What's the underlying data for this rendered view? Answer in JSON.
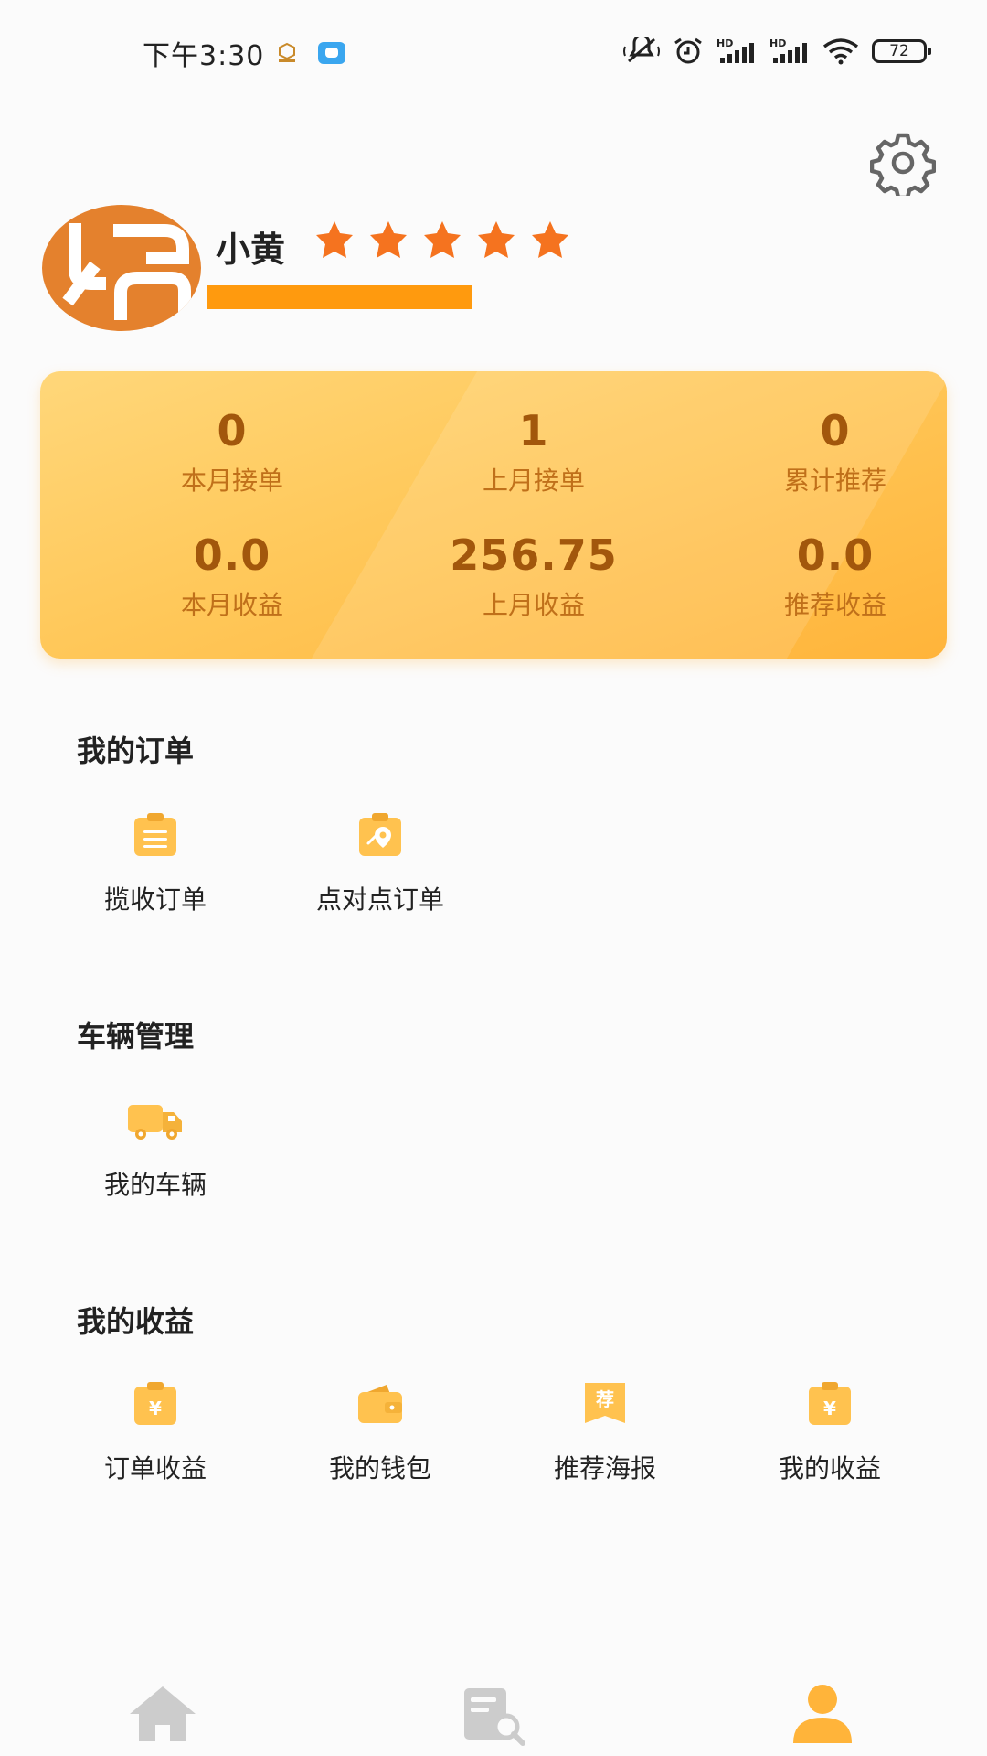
{
  "status_bar": {
    "time": "下午3:30",
    "battery": "72"
  },
  "profile": {
    "name": "小黄",
    "rating_stars": 5
  },
  "stats": [
    {
      "value": "0",
      "label": "本月接单"
    },
    {
      "value": "1",
      "label": "上月接单"
    },
    {
      "value": "0",
      "label": "累计推荐"
    },
    {
      "value": "0.0",
      "label": "本月收益"
    },
    {
      "value": "256.75",
      "label": "上月收益"
    },
    {
      "value": "0.0",
      "label": "推荐收益"
    }
  ],
  "sections": {
    "orders": {
      "title": "我的订单",
      "items": [
        {
          "label": "揽收订单",
          "icon": "clipboard-list-icon"
        },
        {
          "label": "点对点订单",
          "icon": "clipboard-location-icon"
        }
      ]
    },
    "vehicles": {
      "title": "车辆管理",
      "items": [
        {
          "label": "我的车辆",
          "icon": "truck-icon"
        }
      ]
    },
    "earnings": {
      "title": "我的收益",
      "items": [
        {
          "label": "订单收益",
          "icon": "clipboard-yen-icon"
        },
        {
          "label": "我的钱包",
          "icon": "wallet-icon"
        },
        {
          "label": "推荐海报",
          "icon": "poster-icon",
          "glyph": "荐"
        },
        {
          "label": "我的收益",
          "icon": "earnings-yen-icon"
        }
      ]
    }
  },
  "bottom_nav": [
    {
      "icon": "home-icon",
      "active": false
    },
    {
      "icon": "order-search-icon",
      "active": false
    },
    {
      "icon": "user-icon",
      "active": true
    }
  ],
  "colors": {
    "accent": "#ffb43a",
    "star": "#f5731f",
    "nav_active": "#ffb43a",
    "nav_inactive": "#cccccc"
  }
}
